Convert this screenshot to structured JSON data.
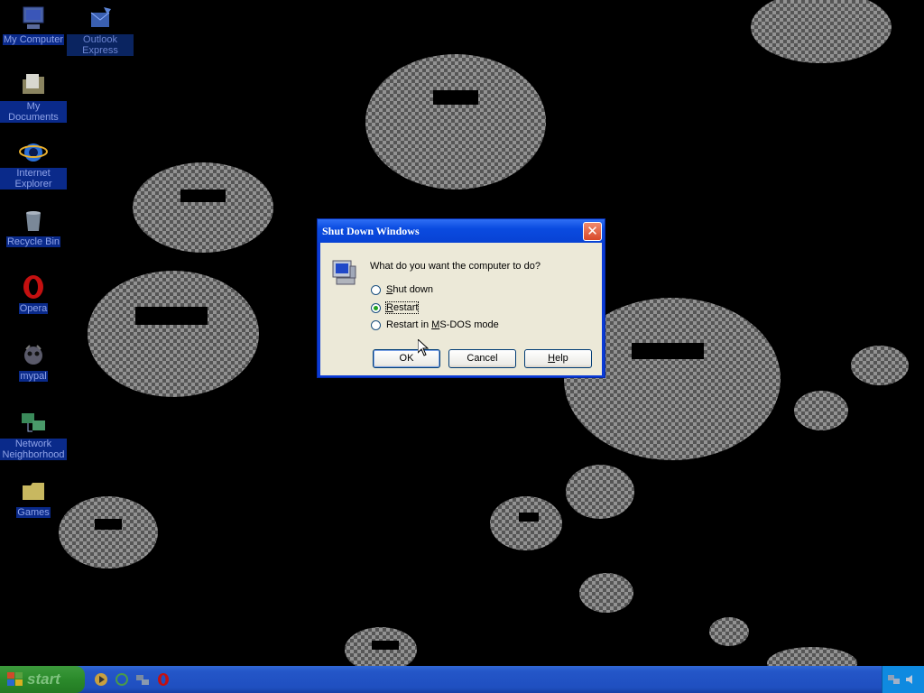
{
  "desktop": {
    "icons": [
      {
        "label": "My Computer",
        "icon": "my-computer-icon"
      },
      {
        "label": "Outlook Express",
        "icon": "outlook-express-icon"
      },
      {
        "label": "My Documents",
        "icon": "my-documents-icon"
      },
      {
        "label": "Internet Explorer",
        "icon": "internet-explorer-icon"
      },
      {
        "label": "Recycle Bin",
        "icon": "recycle-bin-icon"
      },
      {
        "label": "Opera",
        "icon": "opera-icon"
      },
      {
        "label": "mypal",
        "icon": "mypal-icon"
      },
      {
        "label": "Network Neighborhood",
        "icon": "network-neighborhood-icon"
      },
      {
        "label": "Games",
        "icon": "games-folder-icon"
      }
    ]
  },
  "dialog": {
    "title": "Shut Down Windows",
    "close_label": "✕",
    "prompt": "What do you want the computer to do?",
    "options": [
      {
        "label_pre": "",
        "label_key": "S",
        "label_post": "hut down",
        "selected": false
      },
      {
        "label_pre": "",
        "label_key": "R",
        "label_post": "estart",
        "selected": true
      },
      {
        "label_pre": "Restart in ",
        "label_key": "M",
        "label_post": "S-DOS mode",
        "selected": false
      }
    ],
    "buttons": {
      "ok": "OK",
      "cancel": "Cancel",
      "help_key": "H",
      "help_rest": "elp"
    }
  },
  "taskbar": {
    "start_label": "start",
    "quick_launch": [
      "media-player-icon",
      "refresh-icon",
      "network-icon",
      "opera-icon"
    ]
  },
  "colors": {
    "wallpaper_pattern": "#a0a0a0",
    "dialog_face": "#ece9d8",
    "titlebar": "#0a4be0",
    "taskbar": "#2456c8",
    "start_button": "#2b8a2b"
  }
}
